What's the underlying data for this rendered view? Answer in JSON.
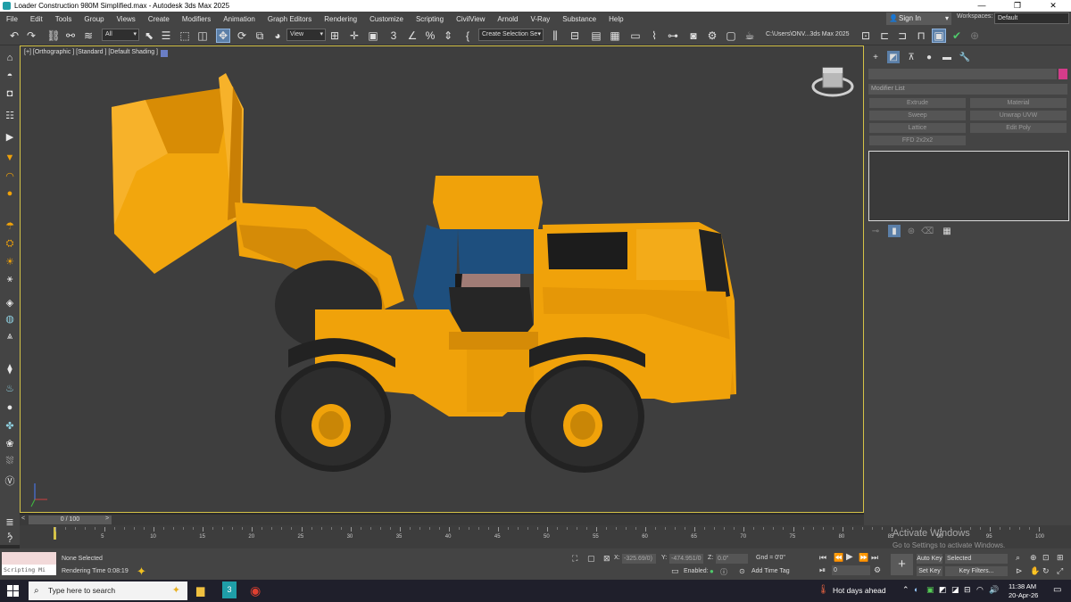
{
  "window": {
    "title": "Loader Construction 980M Simplified.max - Autodesk 3ds Max 2025",
    "controls": [
      "—",
      "❐",
      "✕"
    ]
  },
  "menu": {
    "items": [
      "File",
      "Edit",
      "Tools",
      "Group",
      "Views",
      "Create",
      "Modifiers",
      "Animation",
      "Graph Editors",
      "Rendering",
      "Customize",
      "Scripting",
      "CivilView",
      "Arnold",
      "V-Ray",
      "Substance",
      "Help"
    ],
    "sign_in": "Sign In",
    "workspaces_label": "Workspaces:",
    "workspace_value": "Default"
  },
  "toolbar": {
    "selection_filter": "All",
    "ref_coord": "View",
    "named_selection": "Create Selection Se",
    "path": "C:\\Users\\ONV...3ds Max 2025"
  },
  "viewport": {
    "label": "[+] [Orthographic ] [Standard ] [Default Shading ]",
    "body_color": "#f0a20a",
    "tire_color": "#2a2a2a",
    "glass_color": "#1e4f7e"
  },
  "command_panel": {
    "modifier_list": "Modifier List",
    "buttons": [
      "Extrude",
      "Material",
      "Sweep",
      "Unwrap UVW",
      "Lattice",
      "Edit Poly",
      "FFD 2x2x2"
    ]
  },
  "time": {
    "slider_label": "0 / 100",
    "ticks": [
      "5",
      "10",
      "15",
      "20",
      "25",
      "30",
      "35",
      "40",
      "45",
      "50",
      "55",
      "60",
      "65",
      "70",
      "75",
      "80",
      "85",
      "90",
      "95",
      "100"
    ]
  },
  "status": {
    "script_text": "Scripting Mi",
    "selection": "None Selected",
    "render_time": "Rendering Time  0:08:19",
    "x_label": "X:",
    "x_value": "-325.69/0)",
    "y_label": "Y:",
    "y_value": "-474.951/0",
    "z_label": "Z:",
    "z_value": "0.0\"",
    "grid": "Gnd = 0'0\"",
    "enabled_label": "Enabled:",
    "add_time_tag": "Add Time Tag",
    "frame_value": "0",
    "auto_key": "Auto Key",
    "set_key": "Set Key",
    "key_mode": "Selected",
    "key_filters": "Key Filters..."
  },
  "watermark": {
    "line1": "Activate Windows",
    "line2": "Go to Settings to activate Windows."
  },
  "taskbar": {
    "search_placeholder": "Type here to search",
    "weather": "Hot days ahead",
    "time": "11:38 AM",
    "date": "20-Apr-26"
  }
}
